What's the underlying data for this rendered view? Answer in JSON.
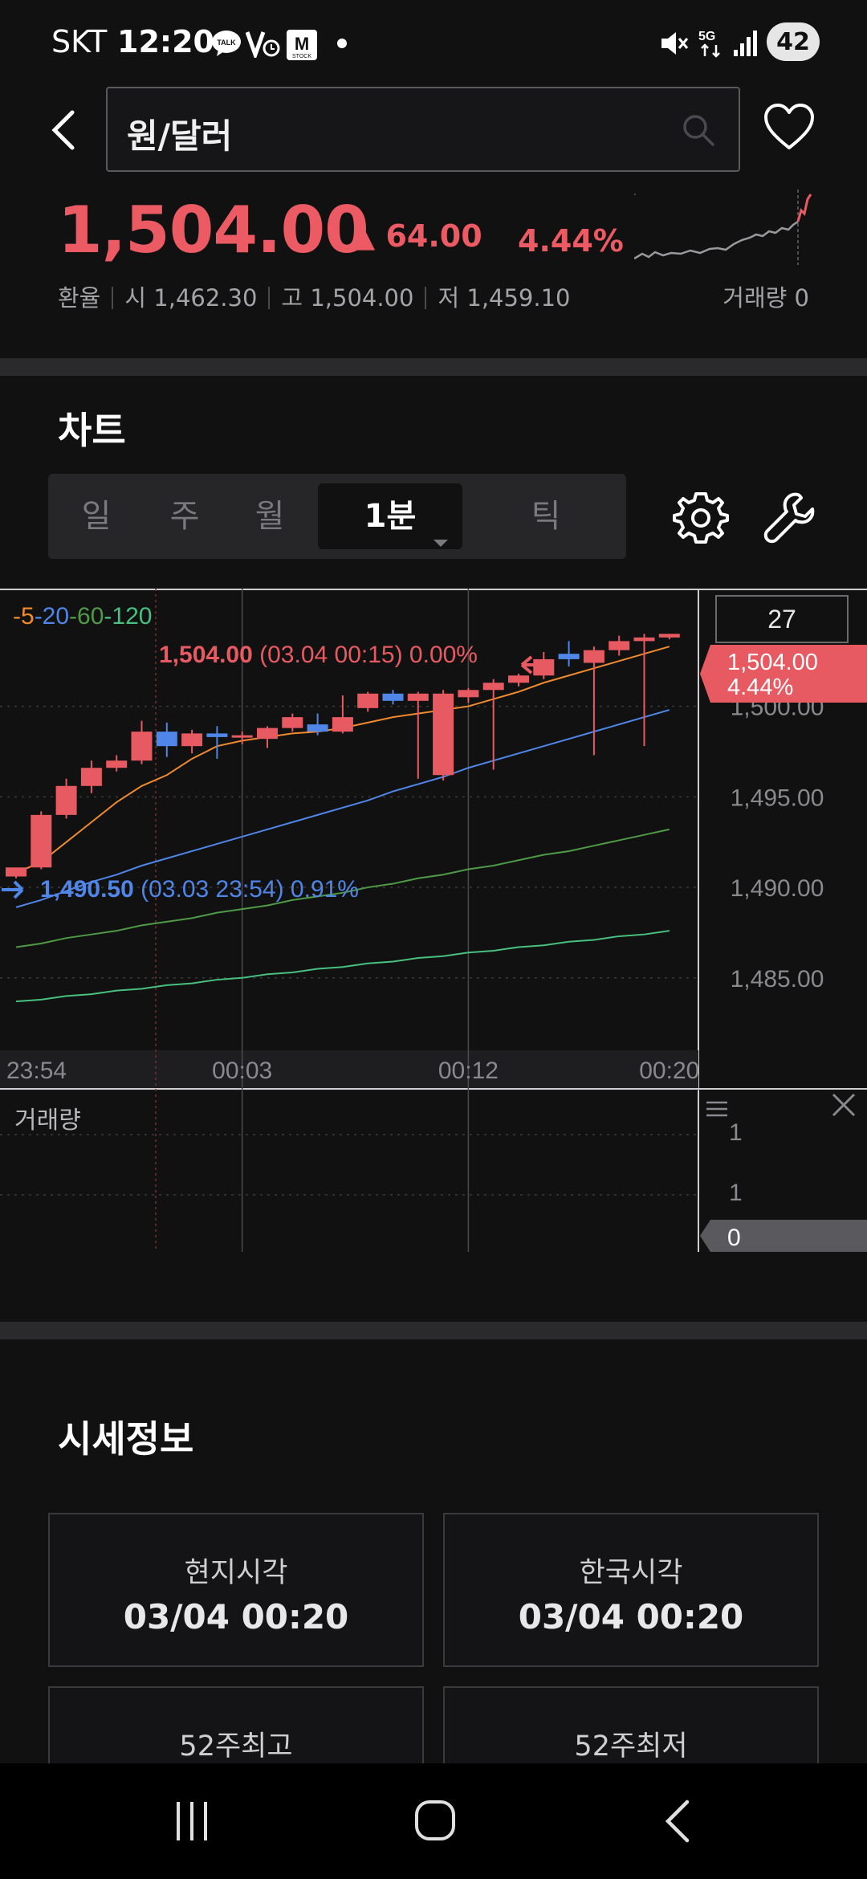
{
  "status_bar": {
    "carrier": "SKT",
    "time": "12:20",
    "battery": "42",
    "network": "5G"
  },
  "header": {
    "search_text": "원/달러"
  },
  "quote": {
    "price": "1,504.00",
    "change": "▲ 64.00",
    "change_pct": "4.44%",
    "label": "환율",
    "open": "시 1,462.30",
    "high": "고 1,504.00",
    "low": "저 1,459.10",
    "volume": "거래량 0"
  },
  "chart_section": {
    "title": "차트",
    "tabs": [
      "일",
      "주",
      "월",
      "1분",
      "틱"
    ],
    "active_tab": "1분"
  },
  "chart_data": {
    "type": "candlestick",
    "ma_legend": [
      {
        "name": "5",
        "color": "#f08a2d"
      },
      {
        "name": "20",
        "color": "#4f86e8"
      },
      {
        "name": "60",
        "color": "#4f9a46"
      },
      {
        "name": "120",
        "color": "#48c080"
      }
    ],
    "ma_sep": "-",
    "x_ticks": [
      "23:54",
      "00:03",
      "00:12",
      "00:20"
    ],
    "y_ticks": [
      "1,500.00",
      "1,495.00",
      "1,490.00",
      "1,485.00"
    ],
    "ylim": [
      1481,
      1506.5
    ],
    "count_box": "27",
    "current_price_tag": "1,504.00",
    "current_pct_tag": "4.44%",
    "high_annotation": {
      "price": "1,504.00",
      "detail": "(03.04 00:15) 0.00%"
    },
    "low_annotation": {
      "price": "1,490.50",
      "detail": "(03.03 23:54) 0.91%"
    },
    "candles": [
      {
        "o": 1490.6,
        "h": 1491.0,
        "l": 1490.5,
        "c": 1491.1,
        "up": true
      },
      {
        "o": 1491.1,
        "h": 1494.2,
        "l": 1491.0,
        "c": 1494.0,
        "up": true
      },
      {
        "o": 1494.0,
        "h": 1496.0,
        "l": 1493.8,
        "c": 1495.6,
        "up": true
      },
      {
        "o": 1495.6,
        "h": 1497.0,
        "l": 1495.2,
        "c": 1496.6,
        "up": true
      },
      {
        "o": 1496.6,
        "h": 1497.3,
        "l": 1496.4,
        "c": 1497.0,
        "up": true
      },
      {
        "o": 1497.0,
        "h": 1499.2,
        "l": 1496.8,
        "c": 1498.6,
        "up": true
      },
      {
        "o": 1498.6,
        "h": 1499.1,
        "l": 1497.2,
        "c": 1497.8,
        "up": false
      },
      {
        "o": 1497.8,
        "h": 1498.7,
        "l": 1497.4,
        "c": 1498.5,
        "up": true
      },
      {
        "o": 1498.5,
        "h": 1498.9,
        "l": 1497.1,
        "c": 1498.3,
        "up": false
      },
      {
        "o": 1498.3,
        "h": 1498.6,
        "l": 1497.9,
        "c": 1498.4,
        "up": true
      },
      {
        "o": 1498.2,
        "h": 1498.9,
        "l": 1497.7,
        "c": 1498.8,
        "up": true
      },
      {
        "o": 1498.8,
        "h": 1499.6,
        "l": 1498.6,
        "c": 1499.4,
        "up": true
      },
      {
        "o": 1499.0,
        "h": 1499.6,
        "l": 1498.4,
        "c": 1498.6,
        "up": false
      },
      {
        "o": 1498.6,
        "h": 1500.6,
        "l": 1498.5,
        "c": 1499.4,
        "up": true
      },
      {
        "o": 1499.9,
        "h": 1500.8,
        "l": 1499.7,
        "c": 1500.7,
        "up": true
      },
      {
        "o": 1500.7,
        "h": 1500.9,
        "l": 1500.1,
        "c": 1500.3,
        "up": false
      },
      {
        "o": 1500.3,
        "h": 1500.8,
        "l": 1496.0,
        "c": 1500.7,
        "up": true
      },
      {
        "o": 1500.7,
        "h": 1500.9,
        "l": 1495.9,
        "c": 1496.2,
        "up": true
      },
      {
        "o": 1500.5,
        "h": 1501.0,
        "l": 1500.2,
        "c": 1500.9,
        "up": true
      },
      {
        "o": 1500.9,
        "h": 1501.5,
        "l": 1496.5,
        "c": 1501.3,
        "up": true
      },
      {
        "o": 1501.3,
        "h": 1501.8,
        "l": 1501.1,
        "c": 1501.7,
        "up": true
      },
      {
        "o": 1501.7,
        "h": 1503.0,
        "l": 1501.5,
        "c": 1502.6,
        "up": true
      },
      {
        "o": 1502.6,
        "h": 1503.6,
        "l": 1502.2,
        "c": 1502.9,
        "up": false
      },
      {
        "o": 1502.4,
        "h": 1503.3,
        "l": 1497.3,
        "c": 1503.1,
        "up": true
      },
      {
        "o": 1503.1,
        "h": 1503.9,
        "l": 1502.8,
        "c": 1503.6,
        "up": true
      },
      {
        "o": 1503.6,
        "h": 1504.0,
        "l": 1497.8,
        "c": 1503.8,
        "up": true
      },
      {
        "o": 1503.8,
        "h": 1504.0,
        "l": 1503.7,
        "c": 1504.0,
        "up": true
      }
    ],
    "ma5": [
      1490.8,
      1491.4,
      1492.5,
      1493.6,
      1494.7,
      1495.6,
      1496.2,
      1497.1,
      1497.8,
      1498.1,
      1498.3,
      1498.5,
      1498.6,
      1498.8,
      1499.1,
      1499.4,
      1499.6,
      1499.8,
      1500.0,
      1500.4,
      1500.8,
      1501.3,
      1501.7,
      1502.1,
      1502.5,
      1502.9,
      1503.3
    ],
    "ma20": [
      1488.9,
      1489.3,
      1489.8,
      1490.3,
      1490.7,
      1491.2,
      1491.6,
      1492.0,
      1492.4,
      1492.8,
      1493.2,
      1493.6,
      1494.0,
      1494.4,
      1494.8,
      1495.3,
      1495.7,
      1496.1,
      1496.6,
      1497.0,
      1497.4,
      1497.8,
      1498.2,
      1498.6,
      1499.0,
      1499.4,
      1499.8
    ],
    "ma60": [
      1486.7,
      1486.9,
      1487.2,
      1487.4,
      1487.6,
      1487.9,
      1488.1,
      1488.3,
      1488.6,
      1488.8,
      1489.0,
      1489.3,
      1489.5,
      1489.7,
      1490.0,
      1490.2,
      1490.5,
      1490.7,
      1491.0,
      1491.2,
      1491.5,
      1491.8,
      1492.0,
      1492.3,
      1492.6,
      1492.9,
      1493.2
    ],
    "ma120": [
      1483.7,
      1483.8,
      1484.0,
      1484.1,
      1484.3,
      1484.4,
      1484.6,
      1484.7,
      1484.9,
      1485.0,
      1485.2,
      1485.3,
      1485.5,
      1485.6,
      1485.8,
      1485.9,
      1486.1,
      1486.2,
      1486.4,
      1486.5,
      1486.7,
      1486.8,
      1487.0,
      1487.1,
      1487.3,
      1487.4,
      1487.6
    ],
    "volume_label": "거래량",
    "volume_ticks": [
      "1",
      "1"
    ],
    "volume_tag": "0"
  },
  "info_section": {
    "title": "시세정보",
    "cards": [
      {
        "label": "현지시각",
        "value": "03/04 00:20"
      },
      {
        "label": "한국시각",
        "value": "03/04 00:20"
      },
      {
        "label": "52주최고",
        "value": ""
      },
      {
        "label": "52주최저",
        "value": ""
      }
    ]
  },
  "colors": {
    "up": "#e85a62",
    "down": "#4f86e8",
    "background": "#111112"
  }
}
